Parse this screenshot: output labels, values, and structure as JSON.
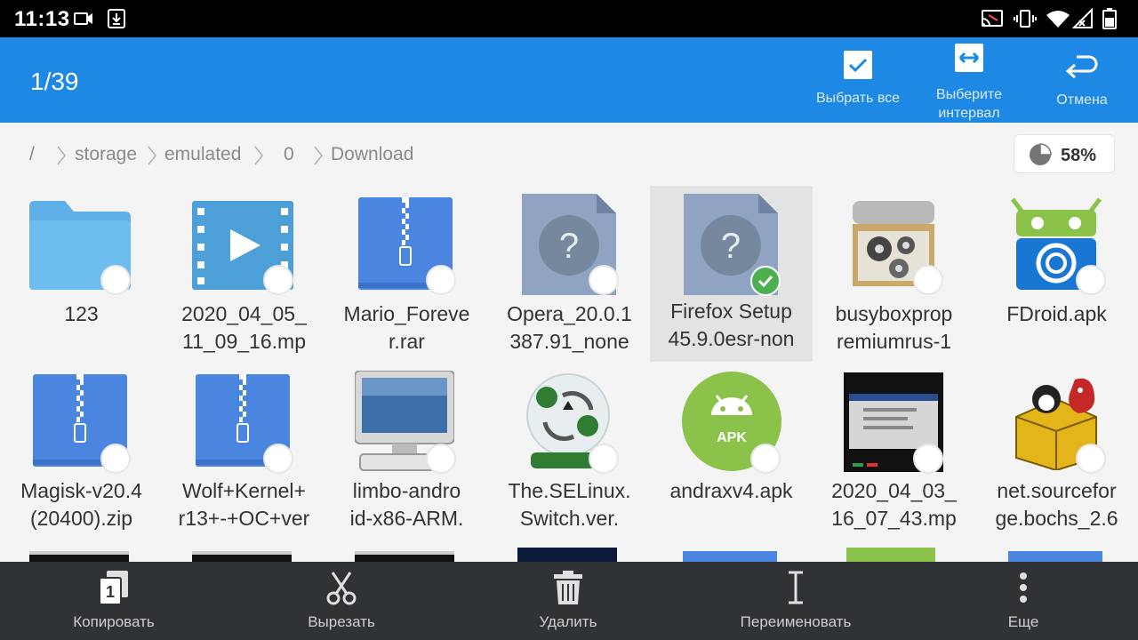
{
  "status_bar": {
    "time": "11:13"
  },
  "header": {
    "counter": "1/39",
    "actions": [
      {
        "label_lines": [
          "Выбрать все"
        ],
        "icon": "select-all-icon"
      },
      {
        "label_lines": [
          "Выберите",
          "интервал"
        ],
        "icon": "select-interval-icon"
      },
      {
        "label_lines": [
          "Отмена"
        ],
        "icon": "undo-icon"
      }
    ]
  },
  "breadcrumb": [
    "/",
    "storage",
    "emulated",
    "0",
    "Download"
  ],
  "storage": {
    "percent_label": "58%",
    "used_fraction": 0.58
  },
  "files": [
    {
      "name_lines": [
        "123",
        ""
      ],
      "icon": "folder-icon",
      "selected": false
    },
    {
      "name_lines": [
        "2020_04_05_",
        "11_09_16.mp"
      ],
      "icon": "video-icon",
      "selected": false
    },
    {
      "name_lines": [
        "Mario_Foreve",
        "r.rar"
      ],
      "icon": "archive-icon",
      "selected": false
    },
    {
      "name_lines": [
        "Opera_20.0.1",
        "387.91_none"
      ],
      "icon": "unknown-file-icon",
      "selected": false
    },
    {
      "name_lines": [
        "Firefox Setup",
        "45.9.0esr-non"
      ],
      "icon": "unknown-file-icon",
      "selected": true
    },
    {
      "name_lines": [
        "busyboxprop",
        "remiumrus-1"
      ],
      "icon": "busybox-app-icon",
      "selected": false
    },
    {
      "name_lines": [
        "FDroid.apk",
        ""
      ],
      "icon": "fdroid-app-icon",
      "selected": false
    },
    {
      "name_lines": [
        "Magisk-v20.4",
        "(20400).zip"
      ],
      "icon": "archive-icon",
      "selected": false
    },
    {
      "name_lines": [
        "Wolf+Kernel+",
        "r13+-+OC+ver"
      ],
      "icon": "archive-icon",
      "selected": false
    },
    {
      "name_lines": [
        "limbo-andro",
        "id-x86-ARM."
      ],
      "icon": "computer-app-icon",
      "selected": false
    },
    {
      "name_lines": [
        "The.SELinux.",
        "Switch.ver."
      ],
      "icon": "selinux-app-icon",
      "selected": false
    },
    {
      "name_lines": [
        "andraxv4.apk",
        ""
      ],
      "icon": "apk-icon",
      "selected": false
    },
    {
      "name_lines": [
        "2020_04_03_",
        "16_07_43.mp"
      ],
      "icon": "video-thumbnail-icon",
      "selected": false
    },
    {
      "name_lines": [
        "net.sourcefor",
        "ge.bochs_2.6"
      ],
      "icon": "bochs-app-icon",
      "selected": false
    }
  ],
  "toolbar": [
    {
      "label": "Копировать",
      "icon": "copy-icon"
    },
    {
      "label": "Вырезать",
      "icon": "cut-icon"
    },
    {
      "label": "Удалить",
      "icon": "delete-icon"
    },
    {
      "label": "Переименовать",
      "icon": "rename-icon"
    },
    {
      "label": "Еще",
      "icon": "more-icon"
    }
  ],
  "colors": {
    "accent": "#1e88e5",
    "check": "#4caf50",
    "bottom_bar": "#303336"
  }
}
